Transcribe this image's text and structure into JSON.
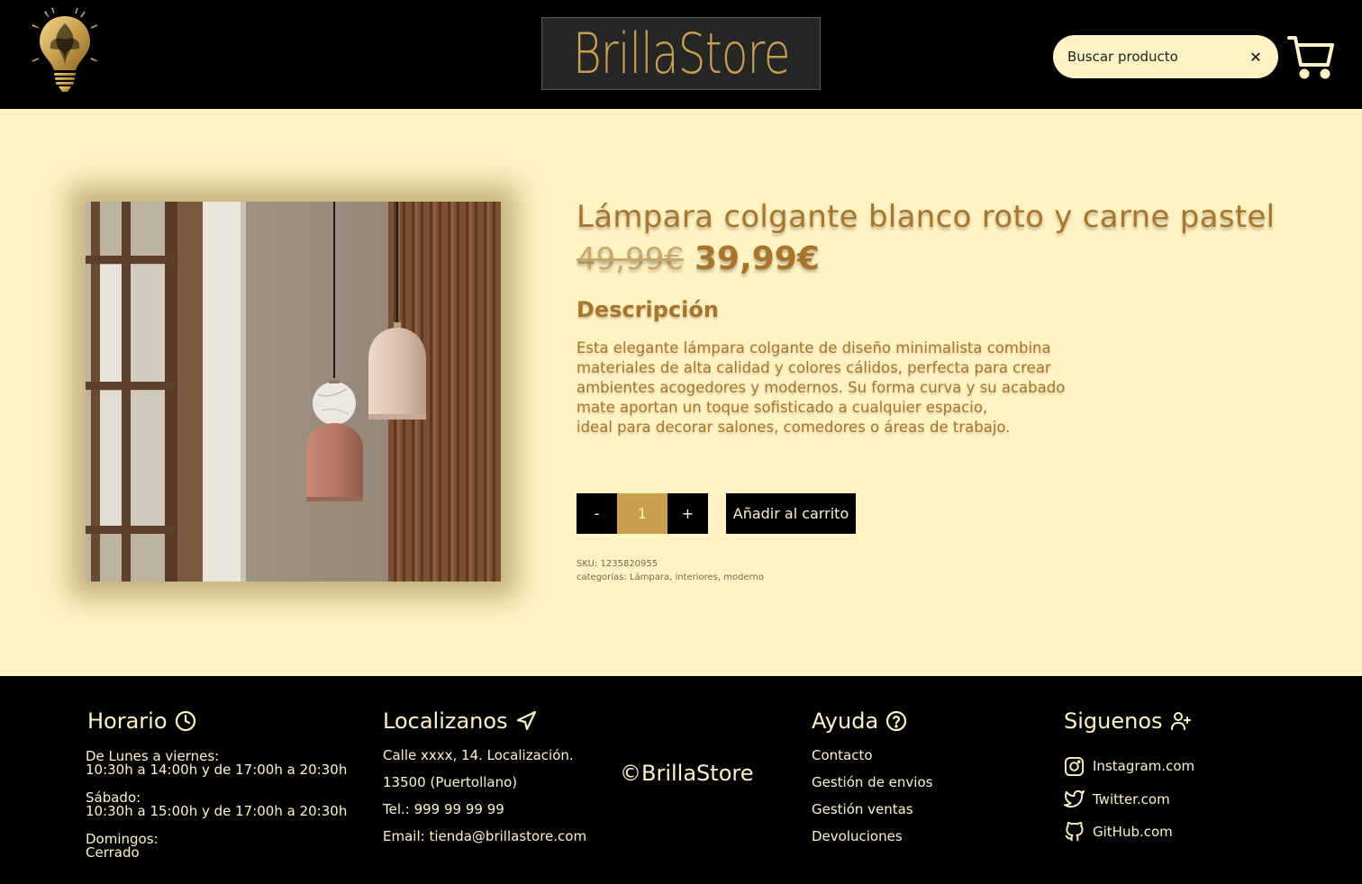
{
  "header": {
    "brand": "BrillaStore",
    "search": {
      "placeholder": "Buscar producto",
      "value": "",
      "clear_label": "✕"
    }
  },
  "product": {
    "title": "Lámpara colgante blanco roto y carne pastel",
    "old_price": "49,99€",
    "price": "39,99€",
    "description_title": "Descripción",
    "description_lines": [
      "Esta elegante lámpara colgante de diseño minimalista combina",
      "materiales de alta calidad y colores cálidos, perfecta para crear",
      "ambientes acogedores y modernos. Su forma curva y su acabado",
      "mate aportan un toque sofisticado a cualquier espacio,",
      "ideal para decorar salones, comedores o áreas de trabajo."
    ],
    "qty_minus": "-",
    "qty_value": "1",
    "qty_plus": "+",
    "add_to_cart": "Añadir al carrito",
    "sku": "SKU: 1235820955",
    "categories": "categorías: Lámpara, interiores, moderno"
  },
  "footer": {
    "schedule": {
      "title": "Horario",
      "weekdays_label": "De Lunes a viernes:",
      "weekdays_hours": "10:30h a 14:00h y de 17:00h a 20:30h",
      "saturday_label": "Sábado:",
      "saturday_hours": "10:30h a 15:00h y de 17:00h a 20:30h",
      "sunday_label": "Domingos:",
      "sunday_hours": "Cerrado"
    },
    "location": {
      "title": "Localizanos",
      "lines": [
        "Calle xxxx, 14. Localización.",
        "13500 (Puertollano)",
        "Tel.: 999 99 99 99",
        "Email: tienda@brillastore.com"
      ]
    },
    "copyright": "©BrillaStore",
    "help": {
      "title": "Ayuda",
      "links": [
        "Contacto",
        "Gestión de envios",
        "Gestión ventas",
        "Devoluciones"
      ]
    },
    "social": {
      "title": "Siguenos",
      "links": [
        "Instagram.com",
        "Twitter.com",
        "GitHub.com"
      ]
    }
  },
  "colors": {
    "header_bg": "#000000",
    "page_bg": "#fff3c4",
    "gold": "#c8a04d",
    "title_brown": "#a8762a"
  },
  "icons": [
    "lightbulb-logo-icon",
    "cart-icon",
    "close-icon",
    "clock-icon",
    "navigation-arrow-icon",
    "help-circle-icon",
    "user-plus-icon",
    "instagram-icon",
    "twitter-icon",
    "github-icon"
  ]
}
